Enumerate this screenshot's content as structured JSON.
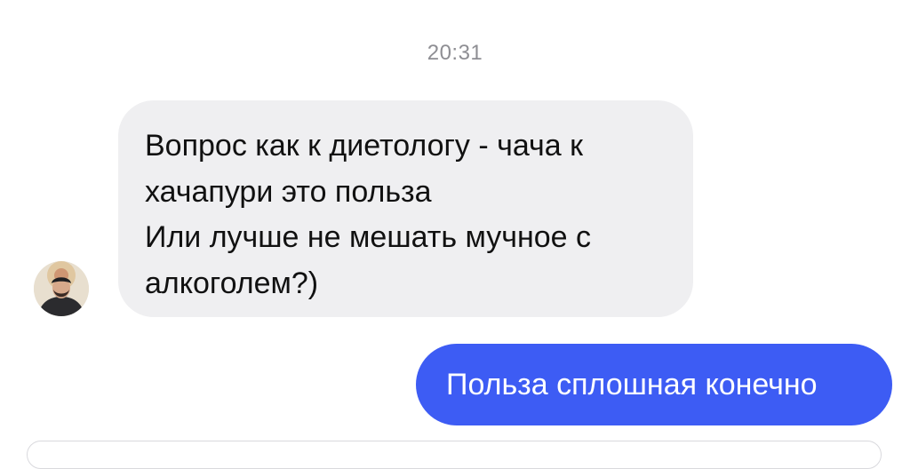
{
  "chat": {
    "timestamp": "20:31",
    "incoming": {
      "avatar_icon": "user-avatar-photo",
      "lines": [
        "Вопрос как к диетологу - чача к",
        "хачапури это польза",
        "Или лучше не мешать мучное с",
        "алкоголем?)"
      ]
    },
    "outgoing": {
      "text": "Польза сплошная конечно"
    }
  },
  "colors": {
    "incoming_bubble": "#efeff1",
    "outgoing_bubble": "#3d5cf4",
    "timestamp_text": "#8e8e93"
  }
}
